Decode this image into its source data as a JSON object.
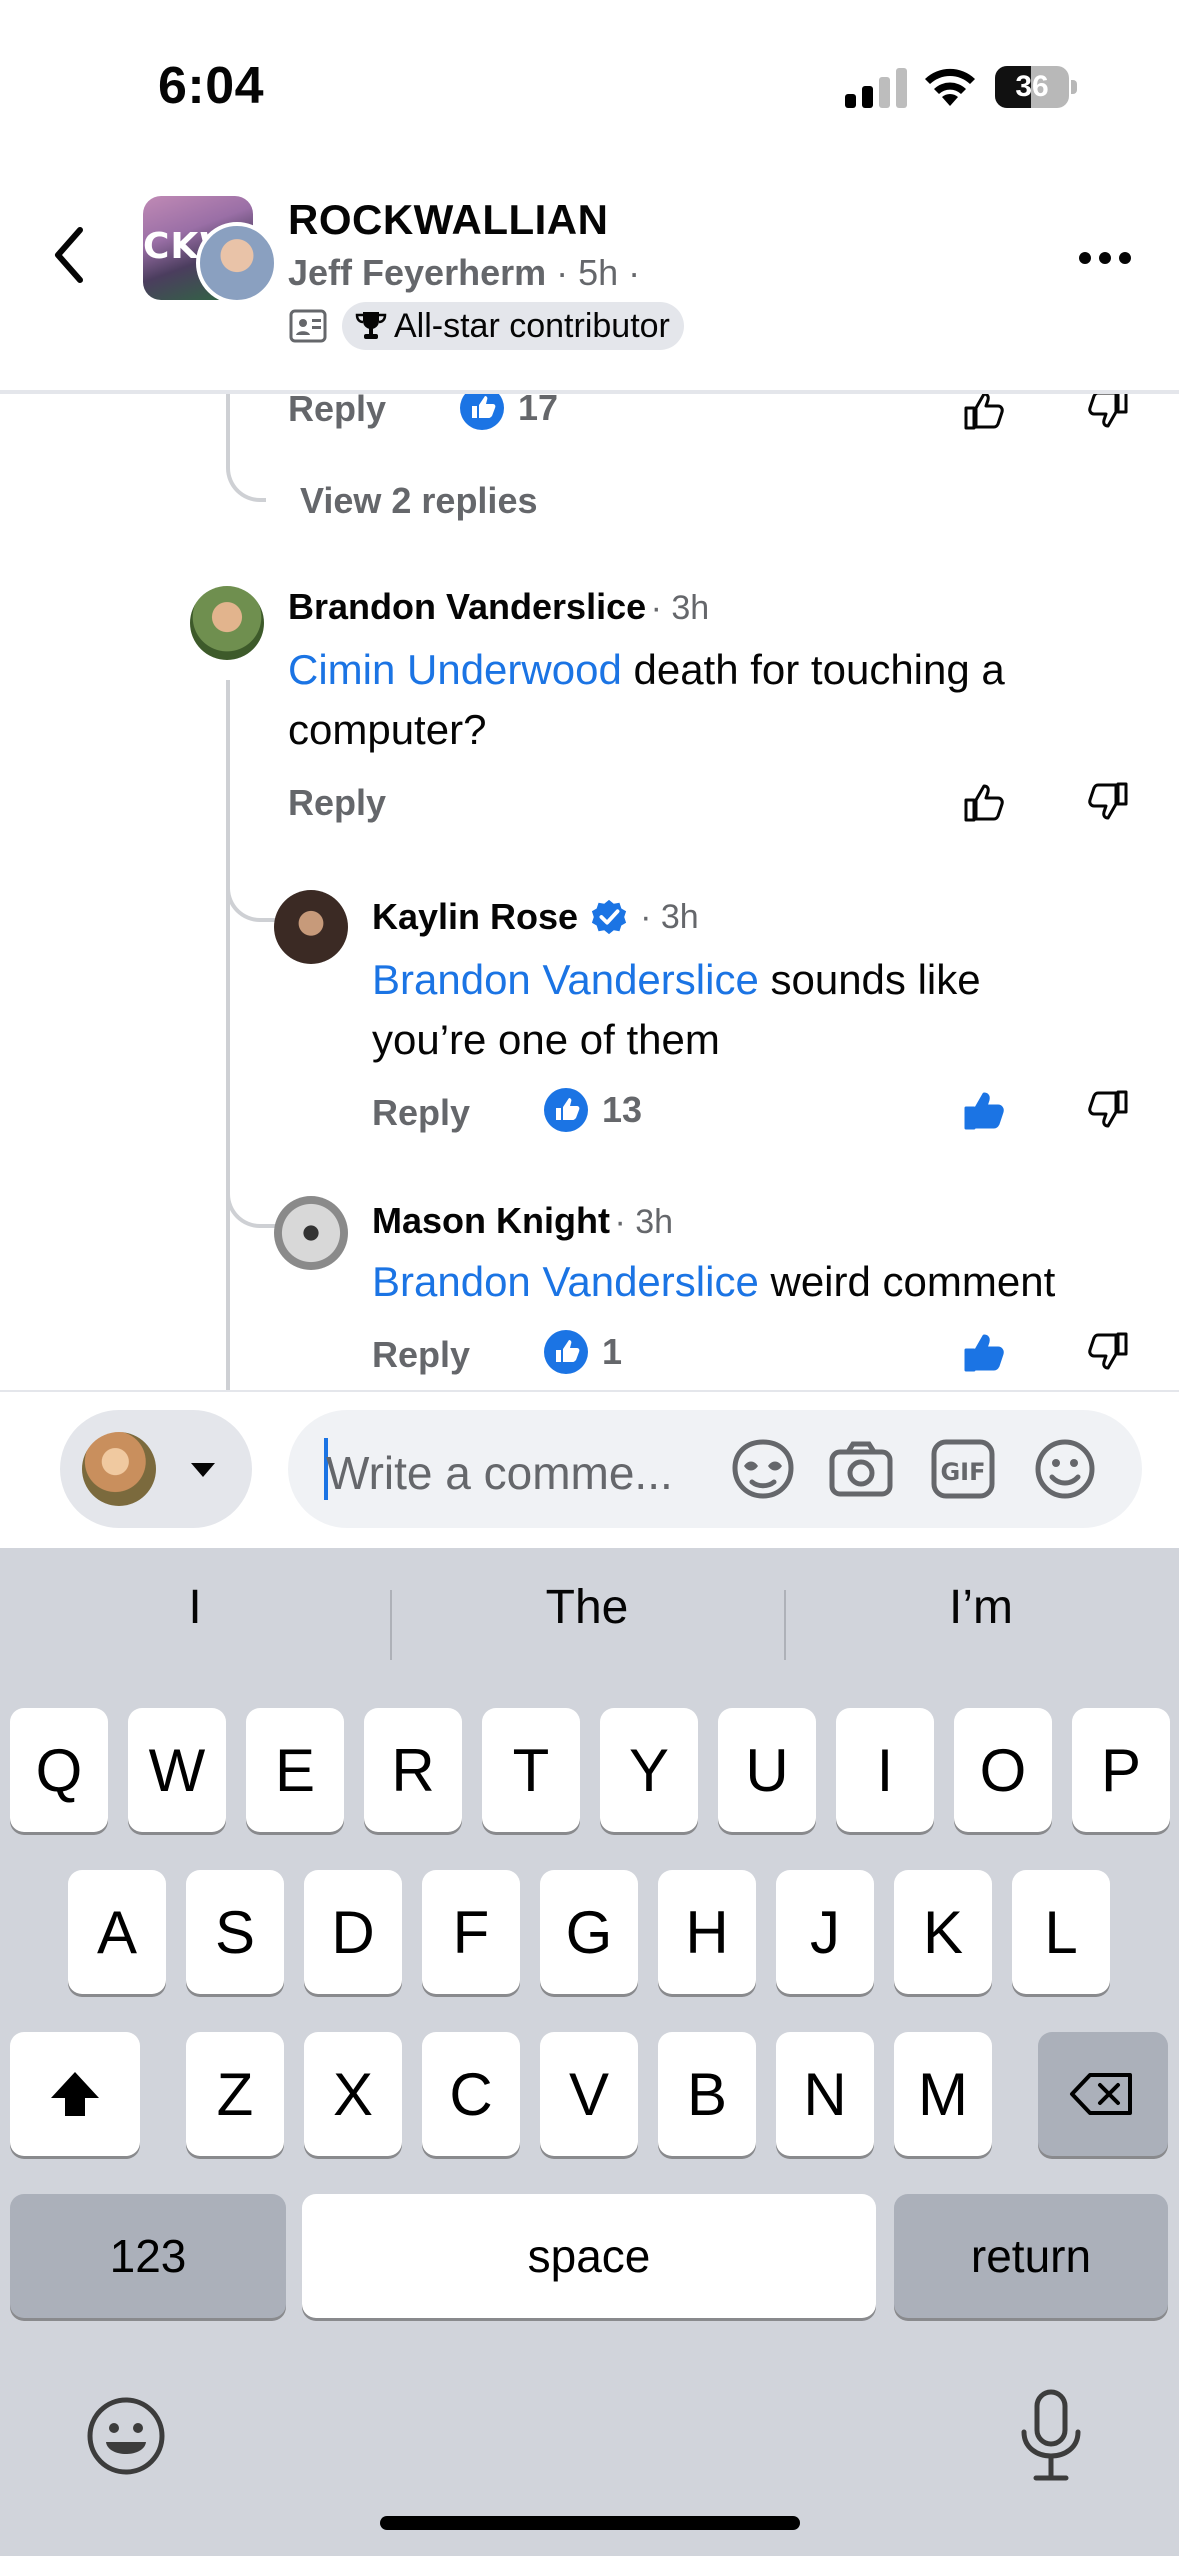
{
  "status_bar": {
    "time": "6:04",
    "battery": "36"
  },
  "header": {
    "group_name": "ROCKWALLIAN",
    "group_pic_text": "CKWA",
    "author": "Jeff Feyerherm",
    "meta": " · 5h ·",
    "badge": "All-star contributor"
  },
  "top_comment_actions": {
    "reply": "Reply",
    "likes": "17"
  },
  "view_replies": "View 2 replies",
  "comments": [
    {
      "name": "Brandon Vanderslice",
      "time": "· 3h",
      "mention": "Cimin Underwood",
      "text_line1": " death for touching a",
      "text_line2": "computer?",
      "reply": "Reply",
      "likes": ""
    },
    {
      "name": "Kaylin Rose",
      "time": "· 3h",
      "mention": "Brandon Vanderslice",
      "text_line1": " sounds like",
      "text_line2": "you’re one of them",
      "reply": "Reply",
      "likes": "13"
    },
    {
      "name": "Mason Knight",
      "time": "· 3h",
      "mention": "Brandon Vanderslice",
      "text_line1": " weird comment",
      "reply": "Reply",
      "likes": "1"
    }
  ],
  "compose": {
    "placeholder": "Write a comme..."
  },
  "keyboard": {
    "suggestions": [
      "I",
      "The",
      "I’m"
    ],
    "row1": [
      "Q",
      "W",
      "E",
      "R",
      "T",
      "Y",
      "U",
      "I",
      "O",
      "P"
    ],
    "row2": [
      "A",
      "S",
      "D",
      "F",
      "G",
      "H",
      "J",
      "K",
      "L"
    ],
    "row3": [
      "Z",
      "X",
      "C",
      "V",
      "B",
      "N",
      "M"
    ],
    "numbers": "123",
    "space": "space",
    "return": "return"
  },
  "colors": {
    "accent": "#1b74e4",
    "secondary_text": "#65676b",
    "keyboard_bg": "#d1d4db"
  }
}
